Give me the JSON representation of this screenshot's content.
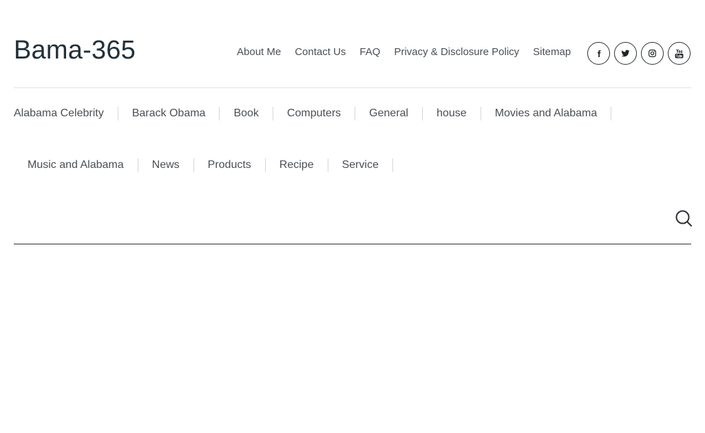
{
  "site": {
    "title": "Bama-365"
  },
  "top_nav": {
    "items": [
      {
        "label": "About Me"
      },
      {
        "label": "Contact Us"
      },
      {
        "label": "FAQ"
      },
      {
        "label": "Privacy & Disclosure Policy"
      },
      {
        "label": "Sitemap"
      }
    ]
  },
  "social": {
    "icons": [
      "facebook-icon",
      "twitter-icon",
      "instagram-icon",
      "youtube-icon"
    ]
  },
  "categories": {
    "row1": [
      {
        "label": "Alabama Celebrity"
      },
      {
        "label": "Barack Obama"
      },
      {
        "label": "Book"
      },
      {
        "label": "Computers"
      },
      {
        "label": "General"
      },
      {
        "label": "house"
      },
      {
        "label": "Movies and Alabama"
      }
    ],
    "row2": [
      {
        "label": "Music and Alabama"
      },
      {
        "label": "News"
      },
      {
        "label": "Products"
      },
      {
        "label": "Recipe"
      },
      {
        "label": "Service"
      }
    ]
  },
  "search": {
    "icon": "search-icon"
  },
  "colors": {
    "text": "#4a4f55",
    "title": "#22303a",
    "divider": "#e3e3e3",
    "search_line": "#2b2f33"
  }
}
